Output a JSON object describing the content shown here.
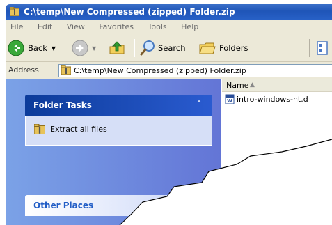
{
  "window": {
    "title": "C:\\temp\\New Compressed (zipped) Folder.zip"
  },
  "menubar": {
    "items": [
      "File",
      "Edit",
      "View",
      "Favorites",
      "Tools",
      "Help"
    ]
  },
  "toolbar": {
    "back_label": "Back",
    "search_label": "Search",
    "folders_label": "Folders"
  },
  "address": {
    "label": "Address",
    "value": "C:\\temp\\New Compressed (zipped) Folder.zip"
  },
  "tasks": {
    "header": "Folder Tasks",
    "extract_label": "Extract all files"
  },
  "places": {
    "header": "Other Places"
  },
  "files": {
    "column_name": "Name",
    "items": [
      "intro-windows-nt.d"
    ]
  },
  "colors": {
    "title_blue": "#2459c2",
    "panel_blue": "#6f8fe0",
    "header_dark_blue": "#0c3b9a",
    "chrome": "#ece9d8"
  }
}
